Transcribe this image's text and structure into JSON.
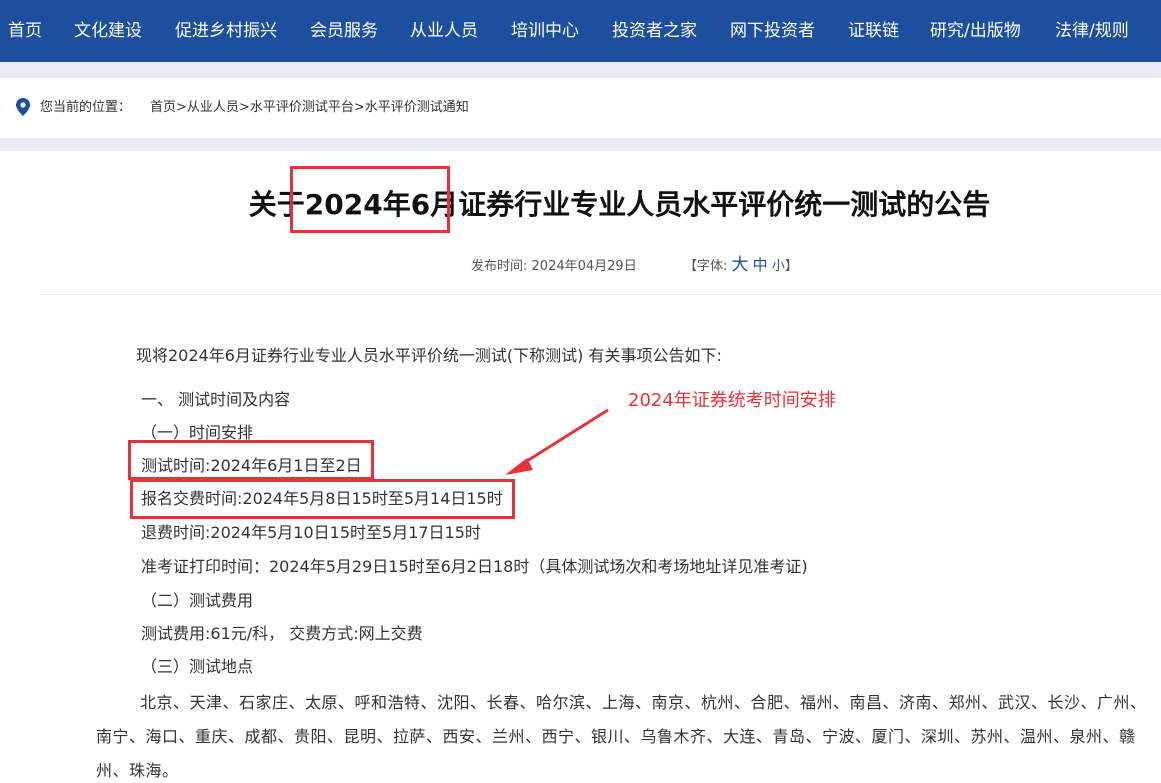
{
  "nav": {
    "items": [
      "首页",
      "文化建设",
      "促进乡村振兴",
      "会员服务",
      "从业人员",
      "培训中心",
      "投资者之家",
      "网下投资者",
      "证联链",
      "研究/出版物",
      "法律/规则"
    ]
  },
  "breadcrumb": {
    "prefix": "您当前的位置：",
    "home": "首页",
    "sep": ">",
    "level1": "从业人员",
    "level2": "水平评价测试平台",
    "current": "水平评价测试通知"
  },
  "article": {
    "title": "关于2024年6月证券行业专业人员水平评价统一测试的公告",
    "publish_label": "发布时间:",
    "publish_date": "2024年04月29日",
    "font_label_open": "【字体:",
    "font_big": "大",
    "font_mid": "中",
    "font_small": "小",
    "font_label_close": "】",
    "intro": "现将2024年6月证券行业专业人员水平评价统一测试(下称测试) 有关事项公告如下:",
    "section1": "一、 测试时间及内容",
    "sub1": "（一）时间安排",
    "test_time": "测试时间:2024年6月1日至2日",
    "register_time": "报名交费时间:2024年5月8日15时至5月14日15时",
    "refund_time": "退费时间:2024年5月10日15时至5月17日15时",
    "admit_print": "准考证打印时间：2024年5月29日15时至6月2日18时（具体测试场次和考场地址详见准考证)",
    "sub2": "（二）测试费用",
    "fee": "测试费用:61元/科， 交费方式:网上交费",
    "sub3": "（三）测试地点",
    "cities": "北京、天津、石家庄、太原、呼和浩特、沈阳、长春、哈尔滨、上海、南京、杭州、合肥、福州、南昌、济南、郑州、武汉、长沙、广州、南宁、海口、重庆、成都、贵阳、昆明、拉萨、西安、兰州、西宁、银川、乌鲁木齐、大连、青岛、宁波、厦门、深圳、苏州、温州、泉州、赣州、珠海。"
  },
  "annotation": {
    "text": "2024年证券统考时间安排",
    "color": "#e8323a"
  },
  "colors": {
    "nav_bg": "#1d4f9f",
    "accent": "#1d4f9f",
    "highlight": "#e8323a"
  }
}
